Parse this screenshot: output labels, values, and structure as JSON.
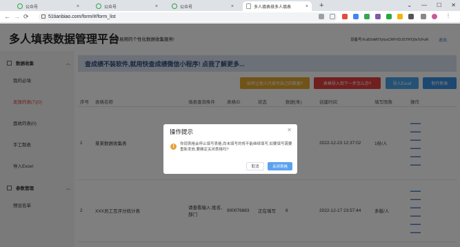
{
  "browser": {
    "tabs": [
      {
        "label": "公众号",
        "active": false
      },
      {
        "label": "公众号",
        "active": false
      },
      {
        "label": "公众号",
        "active": false
      },
      {
        "label": "多人填表排多人填表",
        "active": true
      }
    ],
    "url": "51tianbiao.com/form/#/form_list"
  },
  "header": {
    "site_title": "多人填表数据管理平台",
    "slogan": "提单易用的个性化数据收集服务!",
    "account": "设备号:Ku82oM0TyIcsCRFVDJSTRTj0sTcFuR",
    "logout": "退出"
  },
  "sidebar": {
    "group1": "数据收集",
    "items1": [
      "我的必填",
      "发放的表(7)(0)",
      "面收的表(0)",
      "手工制表",
      "导入Excel"
    ],
    "group2": "参数管理",
    "items2": [
      "预设名单"
    ]
  },
  "main": {
    "banner": "查成绩不装软件,就用快查成绩微信小程序! 点我了解更多...",
    "buttons": [
      "如何让他人只填写自己的数据?",
      "表格导入到下一步怎么办?",
      "导入Excel",
      "制作新表"
    ],
    "columns": [
      "序号",
      "表格名称",
      "填表查询条件",
      "表格ID",
      "状态",
      "数据(条)",
      "创建时间",
      "填写限数",
      "操作"
    ],
    "rows": [
      {
        "index": "1",
        "name": "某某数据收集表",
        "condition": "",
        "id": "",
        "status": "",
        "count": "1",
        "created": "2022-12-23 12:37:02",
        "limit": "1份/人"
      },
      {
        "index": "2",
        "name": "XXX员工互评分统计表",
        "condition": "请查看输入:姓名,部门",
        "id": "900076883",
        "status": "正在填写",
        "count": "6",
        "created": "2022-12-17 23:57:44",
        "limit": "多版/人"
      }
    ]
  },
  "dialog": {
    "title": "操作提示",
    "message": "你现表格会停止填写表格,尚未填写的将不能继续填写,如要填写需要重新发放,要确定关闭表格吗?",
    "cancel": "取消",
    "confirm": "关闭表格"
  },
  "colors": {
    "btn_orange": "#e3a72f",
    "btn_red": "#e0403e",
    "btn_blue": "#4aa4e8",
    "btn_blue2": "#3b90e3",
    "confirm_blue": "#5aa2ef",
    "warn": "#e6a23c"
  }
}
